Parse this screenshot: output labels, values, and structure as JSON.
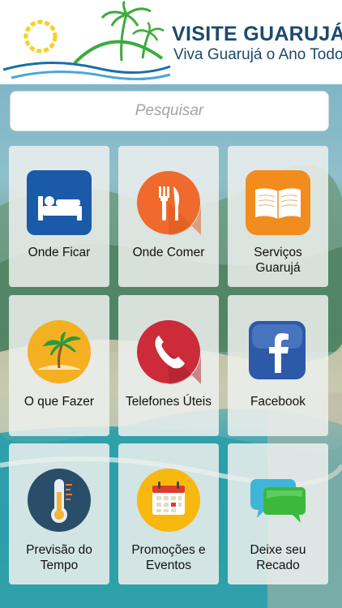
{
  "header": {
    "title": "VISITE GUARUJÁ",
    "subtitle": "Viva Guarujá o Ano Todo"
  },
  "search": {
    "placeholder": "Pesquisar"
  },
  "tiles": [
    {
      "label": "Onde Ficar",
      "icon": "bed-icon",
      "color": "#1a5aa8"
    },
    {
      "label": "Onde Comer",
      "icon": "fork-knife-icon",
      "color": "#ef6a2c"
    },
    {
      "label": "Serviços Guarujá",
      "icon": "book-icon",
      "color": "#f28c1e"
    },
    {
      "label": "O que Fazer",
      "icon": "palm-beach-icon",
      "color": "#f4b021"
    },
    {
      "label": "Telefones Úteis",
      "icon": "phone-icon",
      "color": "#cc2b3a"
    },
    {
      "label": "Facebook",
      "icon": "facebook-icon",
      "color": "#2c5aa8"
    },
    {
      "label": "Previsão do Tempo",
      "icon": "thermometer-icon",
      "color": "#2a4e6a"
    },
    {
      "label": "Promoções e Eventos",
      "icon": "calendar-icon",
      "color": "#f7b80f"
    },
    {
      "label": "Deixe seu Recado",
      "icon": "chat-bubbles-icon",
      "color": "#3cb83c"
    }
  ]
}
